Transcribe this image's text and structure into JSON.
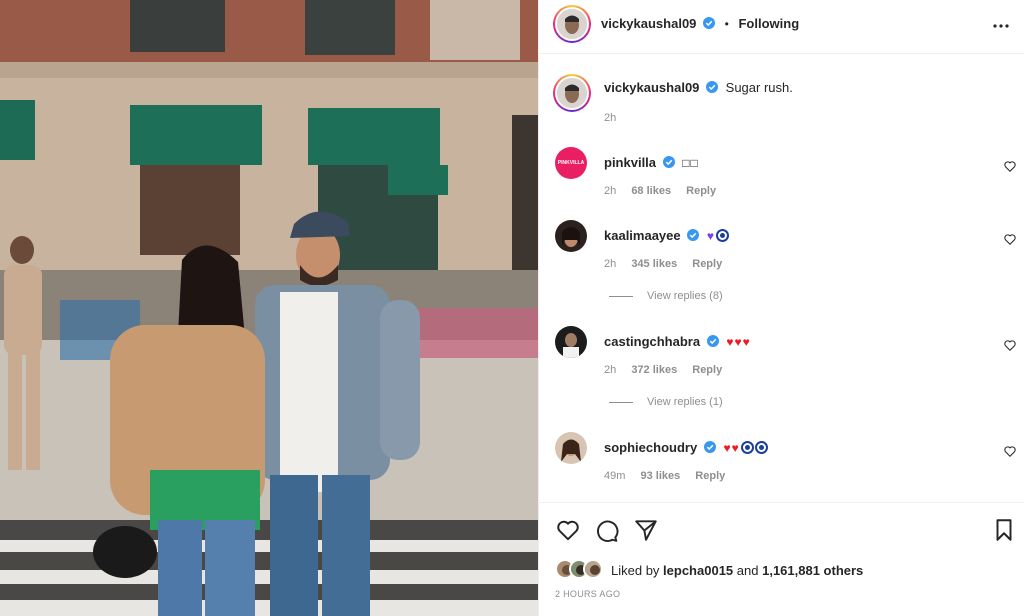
{
  "post": {
    "author": "vickykaushal09",
    "follow_status": "Following",
    "caption": "Sugar rush.",
    "caption_time": "2h"
  },
  "comments": [
    {
      "user": "pinkvilla",
      "text": "□□",
      "time": "2h",
      "likes": "68 likes",
      "reply": "Reply",
      "avatar_label": "PINKVILLA"
    },
    {
      "user": "kaalimaayee",
      "time": "2h",
      "likes": "345 likes",
      "reply": "Reply",
      "view_replies": "View replies (8)"
    },
    {
      "user": "castingchhabra",
      "time": "2h",
      "likes": "372 likes",
      "reply": "Reply",
      "view_replies": "View replies (1)"
    },
    {
      "user": "sophiechoudry",
      "time": "49m",
      "likes": "93 likes",
      "reply": "Reply"
    }
  ],
  "footer": {
    "liked_by_prefix": "Liked by",
    "liked_by_user": "lepcha0015",
    "and": "and",
    "others": "1,161,881 others",
    "posted_ago": "2 HOURS AGO"
  },
  "colors": {
    "verified": "#3897f0",
    "pinkvilla": "#e91e63",
    "heart": "#ed1c24",
    "nazar": "#1b3f9e",
    "purple_heart": "#7b3fe4"
  },
  "icons": [
    "more-icon",
    "heart-icon",
    "comment-icon",
    "share-icon",
    "bookmark-icon",
    "verified-icon"
  ]
}
